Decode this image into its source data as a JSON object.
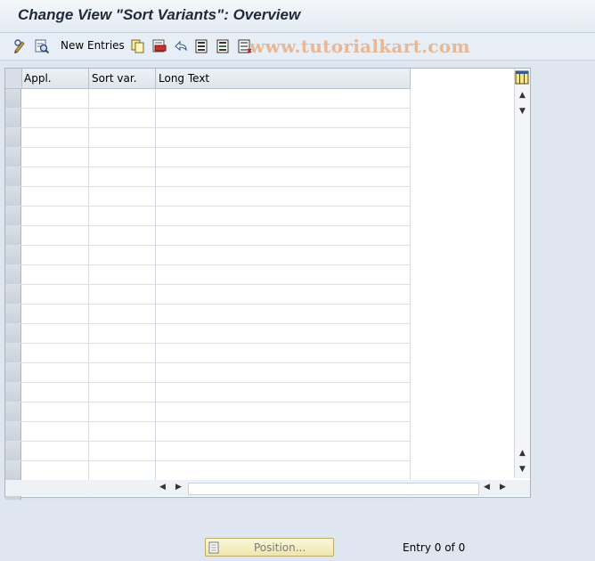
{
  "window": {
    "title": "Change View \"Sort Variants\": Overview"
  },
  "toolbar": {
    "new_entries_label": "New Entries",
    "watermark": "www.tutorialkart.com",
    "icons": [
      "display-change-icon",
      "details-icon",
      "copy-icon",
      "delete-icon",
      "undo-icon",
      "select-all-icon",
      "select-block-icon",
      "deselect-all-icon"
    ]
  },
  "table": {
    "columns": [
      "Appl.",
      "Sort var.",
      "Long Text"
    ],
    "rows": []
  },
  "footer": {
    "position_button_label": "Position...",
    "entry_status": "Entry 0 of 0"
  },
  "colors": {
    "background": "#dfe6ef",
    "watermark": "#e8b38c",
    "position_button": "#efe6ad"
  }
}
